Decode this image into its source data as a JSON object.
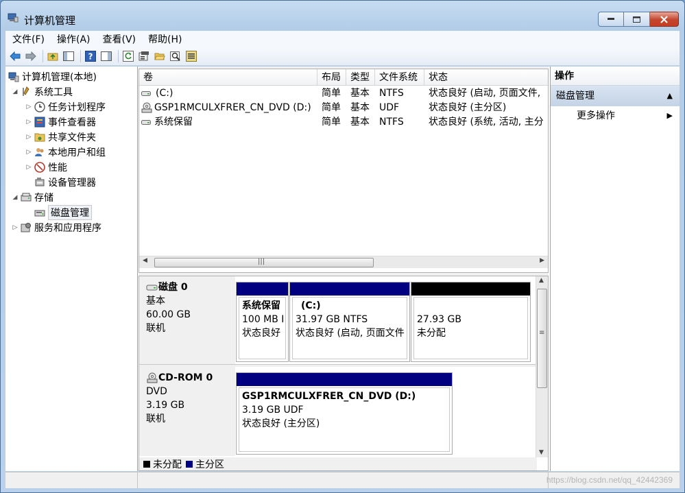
{
  "window": {
    "title": "计算机管理"
  },
  "menu": [
    "文件(F)",
    "操作(A)",
    "查看(V)",
    "帮助(H)"
  ],
  "tree": {
    "root": "计算机管理(本地)",
    "system_tools": "系统工具",
    "task_scheduler": "任务计划程序",
    "event_viewer": "事件查看器",
    "shared_folders": "共享文件夹",
    "local_users": "本地用户和组",
    "performance": "性能",
    "device_manager": "设备管理器",
    "storage": "存储",
    "disk_management": "磁盘管理",
    "services": "服务和应用程序"
  },
  "volumes": {
    "headers": [
      "卷",
      "布局",
      "类型",
      "文件系统",
      "状态"
    ],
    "rows": [
      {
        "volume": "(C:)",
        "layout": "简单",
        "type": "基本",
        "fs": "NTFS",
        "status": "状态良好 (启动, 页面文件, "
      },
      {
        "volume": "GSP1RMCULXFRER_CN_DVD (D:)",
        "layout": "简单",
        "type": "基本",
        "fs": "UDF",
        "status": "状态良好 (主分区)"
      },
      {
        "volume": "系统保留",
        "layout": "简单",
        "type": "基本",
        "fs": "NTFS",
        "status": "状态良好 (系统, 活动, 主分"
      }
    ]
  },
  "disks": {
    "disk0": {
      "name": "磁盘 0",
      "type": "基本",
      "size": "60.00 GB",
      "state": "联机",
      "p1": {
        "name": "系统保留",
        "size": "100 MB I",
        "status": "状态良好"
      },
      "p2": {
        "name": "(C:)",
        "size": "31.97 GB NTFS",
        "status": "状态良好 (启动, 页面文件"
      },
      "p3": {
        "size": "27.93 GB",
        "status": "未分配"
      }
    },
    "cdrom0": {
      "name": "CD-ROM 0",
      "type": "DVD",
      "size": "3.19 GB",
      "state": "联机",
      "p1": {
        "name": "GSP1RMCULXFRER_CN_DVD  (D:)",
        "size": "3.19 GB UDF",
        "status": "状态良好 (主分区)"
      }
    }
  },
  "legend": {
    "unallocated": "未分配",
    "primary": "主分区"
  },
  "colors": {
    "primary": "#000080",
    "unallocated": "#000000"
  },
  "actions": {
    "header": "操作",
    "section": "磁盘管理",
    "more": "更多操作"
  },
  "watermark": "https://blog.csdn.net/qq_42442369"
}
